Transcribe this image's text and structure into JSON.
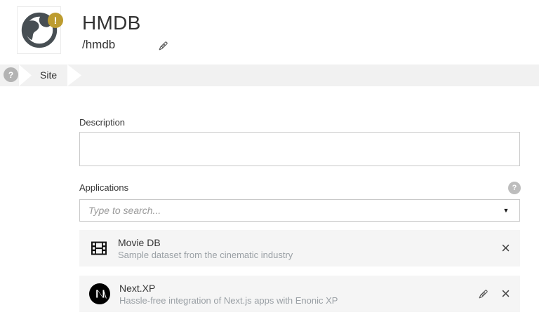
{
  "header": {
    "title": "HMDB",
    "path": "/hmdb",
    "badge_glyph": "!"
  },
  "step_navigator": {
    "help_glyph": "?",
    "steps": [
      {
        "label": "Site"
      }
    ]
  },
  "form": {
    "description": {
      "label": "Description",
      "value": ""
    },
    "applications": {
      "label": "Applications",
      "help_glyph": "?",
      "selector_placeholder": "Type to search...",
      "dropdown_glyph": "▼",
      "items": [
        {
          "name": "Movie DB",
          "description": "Sample dataset from the cinematic industry",
          "icon": "film-strip-icon",
          "remove_glyph": "×"
        },
        {
          "name": "Next.XP",
          "description": "Hassle-free integration of Next.js apps with Enonic XP",
          "icon": "nextjs-icon",
          "remove_glyph": "×"
        }
      ]
    }
  },
  "colors": {
    "badge_gold": "#BD9C2F",
    "icon_dark": "#474E53",
    "row_background": "#F5F5F5",
    "stepbar_background": "#F1F1F1",
    "input_border": "#C9C9C9",
    "text_primary": "#363636",
    "text_secondary": "#9AA0A5"
  }
}
